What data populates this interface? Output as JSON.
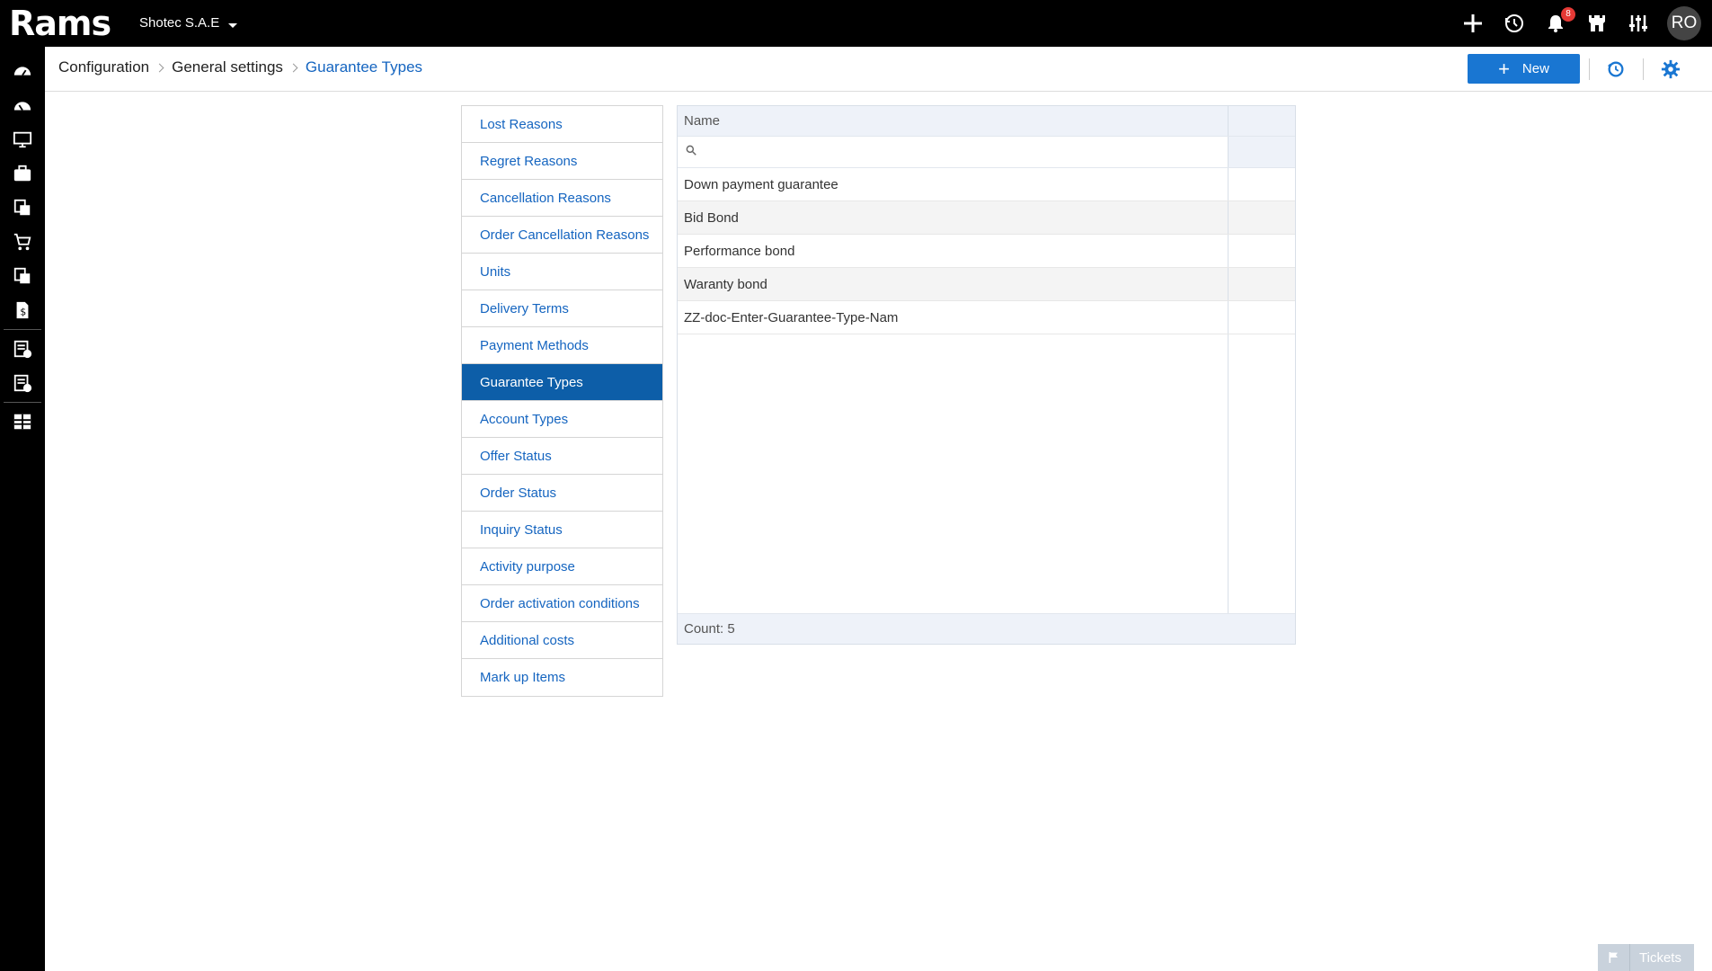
{
  "app": {
    "logo": "Rams",
    "company": "Shotec S.A.E"
  },
  "topbar": {
    "notification_count": "8",
    "avatar_initials": "RO"
  },
  "breadcrumb": [
    {
      "label": "Configuration"
    },
    {
      "label": "General settings"
    },
    {
      "label": "Guarantee Types"
    }
  ],
  "toolbar": {
    "new_label": "New"
  },
  "settings_menu": [
    "Lost Reasons",
    "Regret Reasons",
    "Cancellation Reasons",
    "Order Cancellation Reasons",
    "Units",
    "Delivery Terms",
    "Payment Methods",
    "Guarantee Types",
    "Account Types",
    "Offer Status",
    "Order Status",
    "Inquiry Status",
    "Activity purpose",
    "Order activation conditions",
    "Additional costs",
    "Mark up Items"
  ],
  "active_menu": "Guarantee Types",
  "grid": {
    "column_name": "Name",
    "filter_value": "",
    "rows": [
      "Down payment guarantee",
      "Bid Bond",
      "Performance bond",
      "Waranty bond",
      "ZZ-doc-Enter-Guarantee-Type-Nam"
    ],
    "count_label": "Count: 5"
  },
  "tickets": {
    "label": "Tickets"
  },
  "colors": {
    "accent": "#1976d2",
    "active_menu": "#0d5ea8",
    "link": "#1565c0"
  }
}
